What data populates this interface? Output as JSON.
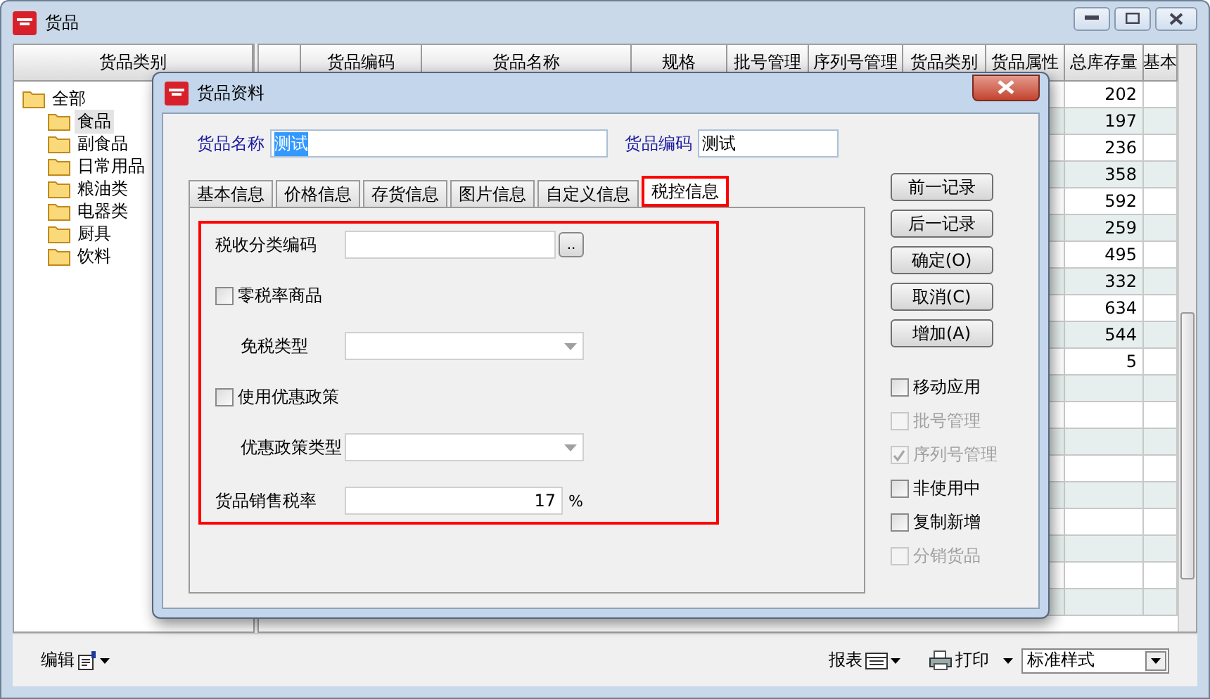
{
  "window": {
    "title": "货品"
  },
  "category_panel": {
    "header": "货品类别",
    "tree": [
      {
        "label": "全部",
        "selected": false,
        "children": [
          {
            "label": "食品",
            "selected": true
          },
          {
            "label": "副食品",
            "selected": false
          },
          {
            "label": "日常用品",
            "selected": false
          },
          {
            "label": "粮油类",
            "selected": false
          },
          {
            "label": "电器类",
            "selected": false
          },
          {
            "label": "厨具",
            "selected": false
          },
          {
            "label": "饮料",
            "selected": false
          }
        ]
      }
    ]
  },
  "grid": {
    "columns": [
      "",
      "货品编码",
      "货品名称",
      "规格",
      "批号管理",
      "序列号管理",
      "货品类别",
      "货品属性",
      "总库存量",
      "基本"
    ],
    "rows": [
      {
        "total_stock": "202"
      },
      {
        "total_stock": "197"
      },
      {
        "total_stock": "236"
      },
      {
        "total_stock": "358"
      },
      {
        "total_stock": "592"
      },
      {
        "total_stock": "259"
      },
      {
        "total_stock": "495"
      },
      {
        "total_stock": "332"
      },
      {
        "total_stock": "634"
      },
      {
        "total_stock": "544"
      },
      {
        "total_stock": "5"
      }
    ]
  },
  "dialog": {
    "title": "货品资料",
    "name_label": "货品名称",
    "name_value": "测试",
    "code_label": "货品编码",
    "code_value": "测试",
    "tabs": [
      {
        "label": "基本信息",
        "selected": false
      },
      {
        "label": "价格信息",
        "selected": false
      },
      {
        "label": "存货信息",
        "selected": false
      },
      {
        "label": "图片信息",
        "selected": false
      },
      {
        "label": "自定义信息",
        "selected": false
      },
      {
        "label": "税控信息",
        "selected": true
      }
    ],
    "tax_fields": [
      {
        "kind": "lookup",
        "label": "税收分类编码",
        "button": ".."
      },
      {
        "kind": "checkbox",
        "label": "零税率商品",
        "checked": false
      },
      {
        "kind": "select",
        "label": "免税类型"
      },
      {
        "kind": "checkbox",
        "label": "使用优惠政策",
        "checked": false
      },
      {
        "kind": "select",
        "label": "优惠政策类型"
      },
      {
        "kind": "percent",
        "label": "货品销售税率",
        "value": "17",
        "unit": "%"
      }
    ],
    "buttons": [
      "前一记录",
      "后一记录",
      "确定(O)",
      "取消(C)",
      "增加(A)"
    ],
    "options": [
      {
        "label": "移动应用",
        "checked": false,
        "disabled": false
      },
      {
        "label": "批号管理",
        "checked": false,
        "disabled": true
      },
      {
        "label": "序列号管理",
        "checked": true,
        "disabled": true
      },
      {
        "label": "非使用中",
        "checked": false,
        "disabled": false
      },
      {
        "label": "复制新增",
        "checked": false,
        "disabled": false
      },
      {
        "label": "分销货品",
        "checked": false,
        "disabled": true
      }
    ]
  },
  "toolbar": {
    "edit": "编辑",
    "report": "报表",
    "print": "打印",
    "style_select": "标准样式"
  }
}
